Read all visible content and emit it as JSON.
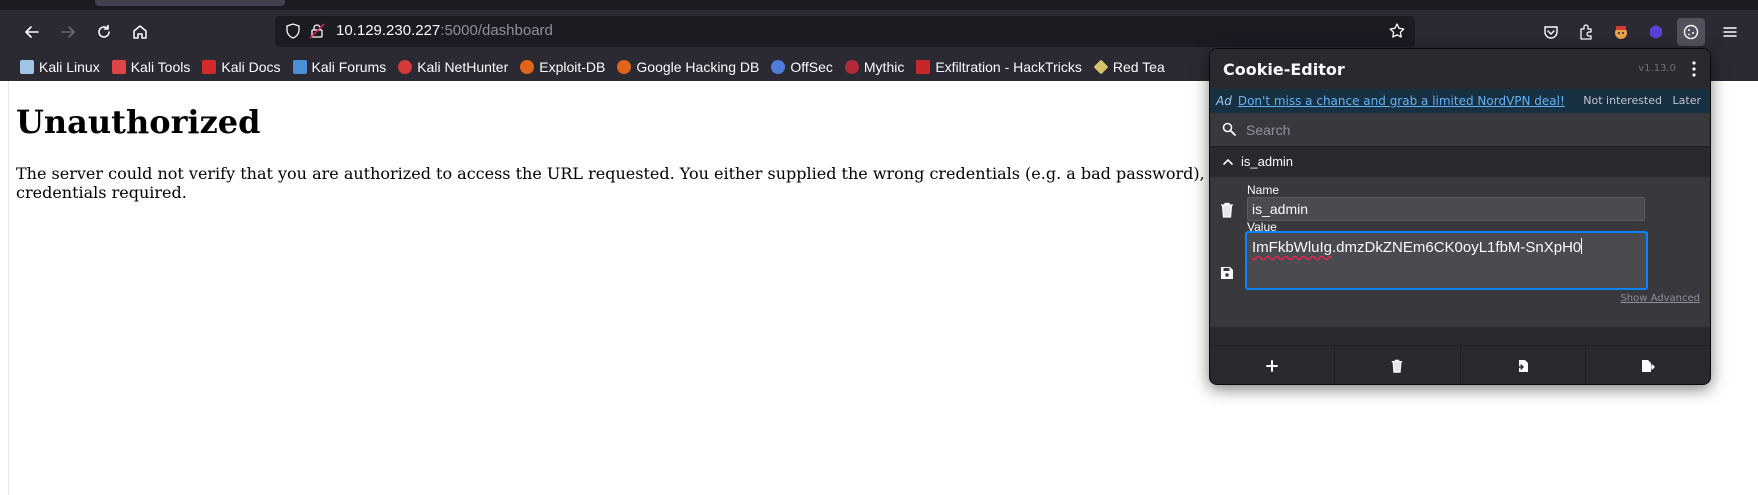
{
  "browser": {
    "url_host": "10.129.230.227",
    "url_path": ":5000/dashboard"
  },
  "bookmarks": [
    {
      "label": "Kali Linux",
      "icon": "kali-dragon-icon",
      "color": "#9ec4e6"
    },
    {
      "label": "Kali Tools",
      "icon": "kali-tools-icon",
      "color": "#e04545"
    },
    {
      "label": "Kali Docs",
      "icon": "kali-docs-icon",
      "color": "#d42a2a"
    },
    {
      "label": "Kali Forums",
      "icon": "kali-forums-icon",
      "color": "#4a90d9"
    },
    {
      "label": "Kali NetHunter",
      "icon": "nethunter-icon",
      "color": "#d43a3a"
    },
    {
      "label": "Exploit-DB",
      "icon": "exploit-db-icon",
      "color": "#e0641a"
    },
    {
      "label": "Google Hacking DB",
      "icon": "ghdb-icon",
      "color": "#e0641a"
    },
    {
      "label": "OffSec",
      "icon": "offsec-icon",
      "color": "#4f7ddb"
    },
    {
      "label": "Mythic",
      "icon": "mythic-icon",
      "color": "#b02a3a"
    },
    {
      "label": "Exfiltration - HackTricks",
      "icon": "hacktricks-icon",
      "color": "#c62828"
    },
    {
      "label": "Red Tea",
      "icon": "red-team-icon",
      "color": "#d8c36a"
    }
  ],
  "page": {
    "heading": "Unauthorized",
    "message": "The server could not verify that you are authorized to access the URL requested. You either supplied the wrong credentials (e.g. a bad password), credentials required."
  },
  "cookie_editor": {
    "title": "Cookie-Editor",
    "version": "v1.13.0",
    "ad_label": "Ad",
    "ad_link": "Don't miss a chance and grab a limited NordVPN deal!",
    "ad_not_interested": "Not interested",
    "ad_later": "Later",
    "search_placeholder": "Search",
    "cookie_name": "is_admin",
    "name_label": "Name",
    "name_value": "is_admin",
    "value_label": "Value",
    "value_prefix": "ImFkbWluIg",
    "value_rest": ".dmzDkZNEm6CK0oyL1fbM-SnXpH0",
    "show_advanced": "Show Advanced"
  }
}
